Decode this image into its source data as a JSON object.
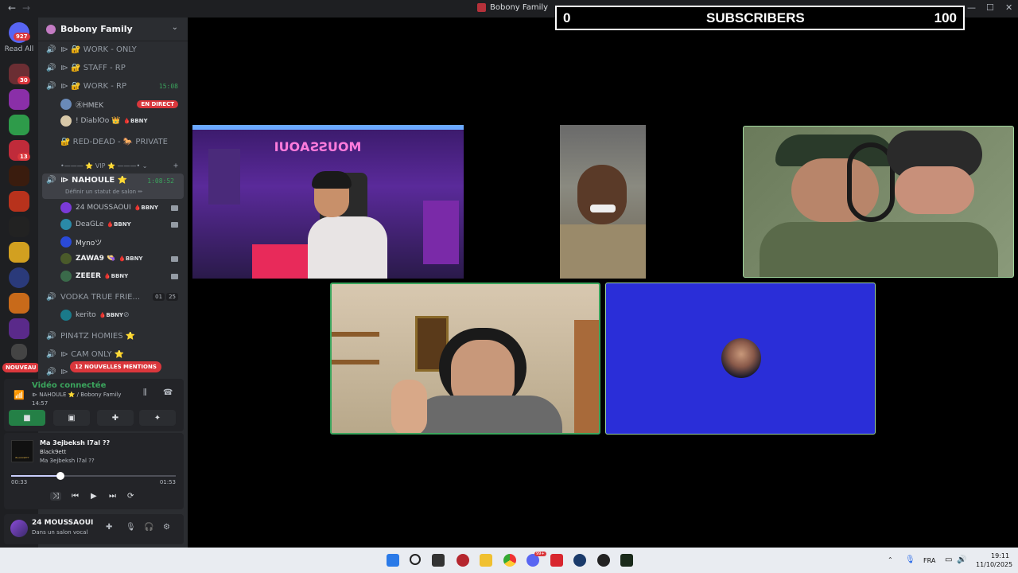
{
  "window": {
    "title": "Bobony Family",
    "back": "←",
    "forward": "→",
    "minimize": "—",
    "maximize": "☐",
    "close": "✕"
  },
  "guild_sidebar": {
    "read_all": "Read All",
    "main_badge": "927",
    "badges": [
      "30",
      "13"
    ],
    "nouveau": "NOUVEAU"
  },
  "server": {
    "name": "Bobony Family",
    "chevron": "⌄"
  },
  "channels": [
    {
      "name": "⧐ 🔐 WORK - ONLY"
    },
    {
      "name": "⧐ 🔐 STAFF - RP"
    },
    {
      "name": "⧐ 🔐 WORK - RP",
      "time": "15:08"
    },
    {
      "name": "🔐 RED-DEAD - 🐎 PRIVATE"
    },
    {
      "name": "•——— ⭐ VIP ⭐ ———•  ⌄",
      "add": "+"
    },
    {
      "name": "⧐ NAHOULE ⭐",
      "time": "1:08:52",
      "status": "Définir un statut de salon ✏"
    },
    {
      "name": "VODKA TRUE FRIE...",
      "count1": "01",
      "count2": "25"
    },
    {
      "name": "PIN4TZ HOMIES ⭐"
    },
    {
      "name": "⧐ CAM ONLY ⭐"
    },
    {
      "name": "⧐"
    }
  ],
  "work_rp_users": [
    {
      "name": "㊍HMEK",
      "badge": "EN DIRECT"
    },
    {
      "name": "! DiablOo 👑",
      "tag": "🩸BBNY"
    }
  ],
  "nahoule_users": [
    {
      "name": "24 MOUSSAOUI",
      "tag": "🩸BBNY"
    },
    {
      "name": "DeaGLe",
      "tag": "🩸BBNY"
    },
    {
      "name": "Mynoツ",
      "tag": ""
    },
    {
      "name": "ZAWA9 👒",
      "tag": "🩸BBNY"
    },
    {
      "name": "ZEEER",
      "tag": "🩸BBNY"
    }
  ],
  "vodka_users": [
    {
      "name": "kerito",
      "tag": "🩸BBNY"
    }
  ],
  "mentions_pill": "12 NOUVELLES MENTIONS",
  "voice": {
    "title": "Vidéo connectée",
    "subtitle": "⧐ NAHOULE ⭐ / Bobony Family",
    "time": "14:57"
  },
  "music": {
    "title": "Ma 3ejbeksh l7al ??",
    "artist": "Black9ett",
    "album": "Ma 3ejbeksh l7al ??",
    "elapsed": "00:33",
    "duration": "01:53",
    "progress": 0.3,
    "cover_text": "BLACK9ETT"
  },
  "user": {
    "name": "24 MOUSSAOUI",
    "status": "Dans un salon vocal"
  },
  "overlay": {
    "left": "0",
    "center": "SUBSCRIBERS",
    "right": "100"
  },
  "stream": {
    "sign_text": "MOUSSAOUI"
  },
  "taskbar": {
    "lang": "FRA",
    "time": "19:11",
    "date": "11/10/2025",
    "badge": "99+"
  }
}
